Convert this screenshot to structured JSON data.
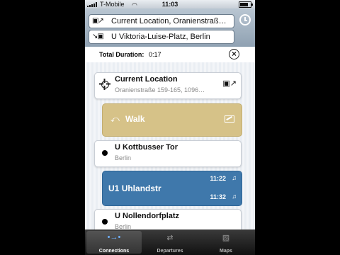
{
  "status_bar": {
    "carrier": "T-Mobile",
    "time": "11:03",
    "battery_level": 0.8
  },
  "search": {
    "from": "Current Location, Oranienstraß…",
    "to": "U Viktoria-Luise-Platz, Berlin",
    "from_icon": "train-arrow-icon",
    "to_icon": "arrow-train-icon"
  },
  "summary": {
    "label": "Total Duration:",
    "value": "0:17"
  },
  "legs": [
    {
      "title": "Current Location",
      "subtitle": "Oranienstraße 159-165, 1096…"
    },
    {
      "title": "Walk"
    },
    {
      "title": "U Kottbusser Tor",
      "subtitle": "Berlin"
    },
    {
      "line": "U1",
      "destination": "Uhlandstr",
      "depart": "11:22",
      "arrive": "11:32"
    },
    {
      "title": "U Nollendorfplatz",
      "subtitle": "Berlin"
    }
  ],
  "tabs": [
    {
      "label": "Connections",
      "icon": "connections-icon",
      "active": true
    },
    {
      "label": "Departures",
      "icon": "departures-icon",
      "active": false
    },
    {
      "label": "Maps",
      "icon": "maps-icon",
      "active": false
    }
  ],
  "colors": {
    "walk": "#d6c288",
    "line": "#3f78ab",
    "header": "#a3b3c2"
  }
}
